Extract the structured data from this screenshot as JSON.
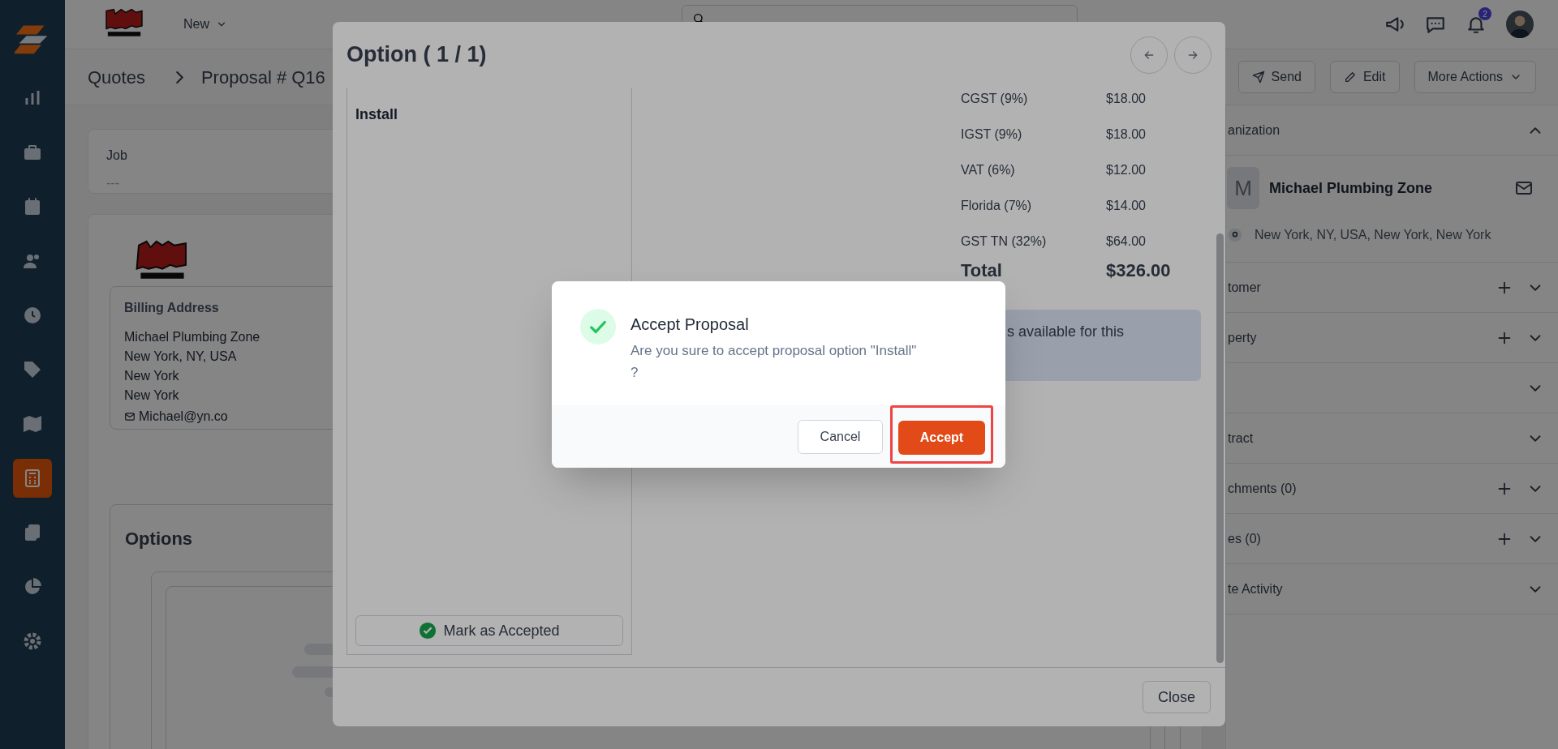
{
  "sidebar": {
    "items": [
      {
        "selected": false
      },
      {
        "selected": false
      },
      {
        "selected": false
      },
      {
        "selected": false
      },
      {
        "selected": false
      },
      {
        "selected": false
      },
      {
        "selected": false
      },
      {
        "selected": true
      },
      {
        "selected": false
      },
      {
        "selected": false
      },
      {
        "selected": false
      }
    ]
  },
  "topbar": {
    "new_menu": "New",
    "notification_count": "2"
  },
  "breadcrumb": [
    "Quotes",
    "Proposal # Q16"
  ],
  "actions": [
    "Send",
    "Edit",
    "More Actions"
  ],
  "job": {
    "label": "Job",
    "value": "---"
  },
  "billing": {
    "title": "Billing Address",
    "lines": [
      "Michael Plumbing Zone",
      "New York, NY, USA",
      "New York",
      "New York"
    ],
    "email": "Michael@yn.co"
  },
  "options": {
    "title": "Options"
  },
  "right_panel": {
    "organization": {
      "avatar": "M",
      "name": "Michael Plumbing Zone",
      "address": "New York, NY, USA, New York, New York"
    },
    "sections": [
      {
        "title": "anization",
        "expanded": true,
        "addable": false
      },
      {
        "title": "tomer",
        "expanded": false,
        "addable": true
      },
      {
        "title": "perty",
        "expanded": false,
        "addable": true
      },
      {
        "expanded": false,
        "addable": false
      },
      {
        "title": "tract",
        "expanded": false,
        "addable": false
      },
      {
        "title": "chments (0)",
        "expanded": false,
        "addable": true
      },
      {
        "title": "es (0)",
        "expanded": false,
        "addable": true
      },
      {
        "title": "te Activity",
        "expanded": false,
        "addable": false
      }
    ]
  },
  "option_modal": {
    "title": "Option ( 1 / 1)",
    "option_name": "Install",
    "mark_button": "Mark as Accepted",
    "taxes": [
      {
        "label": "CGST (9%)",
        "amount": "$18.00"
      },
      {
        "label": "IGST (9%)",
        "amount": "$18.00"
      },
      {
        "label": "VAT (6%)",
        "amount": "$12.00"
      },
      {
        "label": "Florida (7%)",
        "amount": "$14.00"
      },
      {
        "label": "GST TN (32%)",
        "amount": "$64.00"
      }
    ],
    "total": {
      "label": "Total",
      "amount": "$326.00"
    },
    "notice": "s available for this",
    "close": "Close"
  },
  "confirm": {
    "title": "Accept Proposal",
    "message": "Are you sure to accept proposal option \"Install\" ?",
    "buttons": [
      {
        "label": "Cancel",
        "kind": "secondary",
        "highlighted": false
      },
      {
        "label": "Accept",
        "kind": "primary",
        "highlighted": true
      }
    ]
  }
}
